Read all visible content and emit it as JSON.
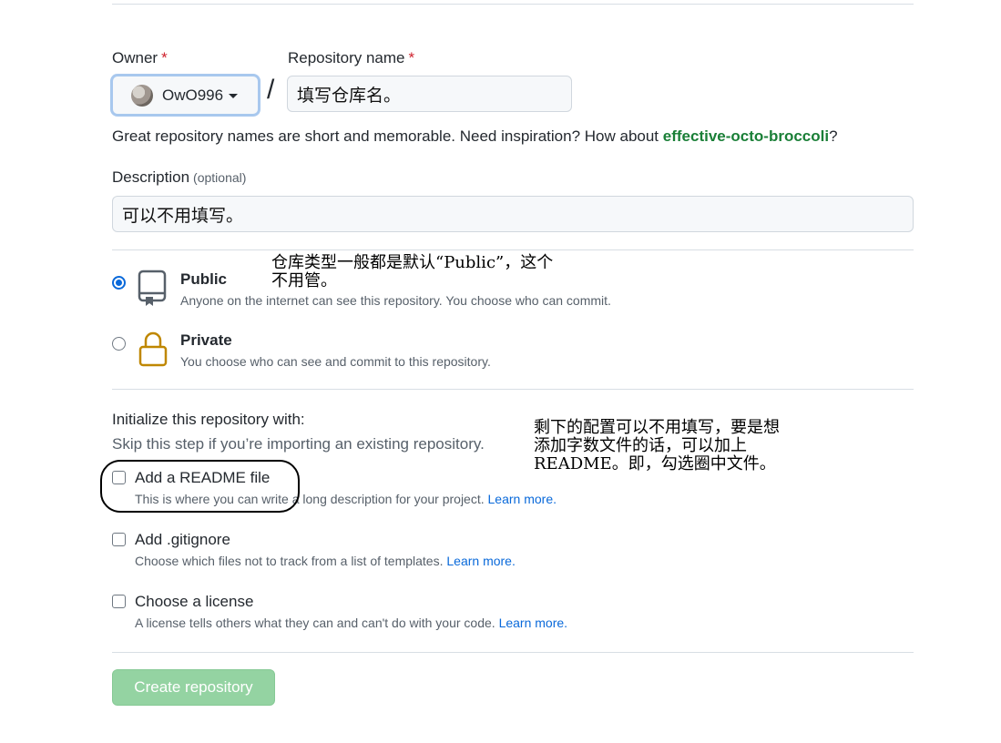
{
  "owner": {
    "label": "Owner",
    "required_mark": "*",
    "value": "OwO996"
  },
  "repo_name": {
    "label": "Repository name",
    "required_mark": "*",
    "value": "填写仓库名。"
  },
  "name_hint": {
    "prefix": "Great repository names are short and memorable. Need inspiration? How about ",
    "suggestion": "effective-octo-broccoli",
    "suffix": "?"
  },
  "description": {
    "label": "Description",
    "optional": "(optional)",
    "value": "可以不用填写。"
  },
  "visibility": {
    "public": {
      "title": "Public",
      "desc": "Anyone on the internet can see this repository. You choose who can commit.",
      "checked": true
    },
    "private": {
      "title": "Private",
      "desc": "You choose who can see and commit to this repository.",
      "checked": false
    }
  },
  "initialize": {
    "heading": "Initialize this repository with:",
    "subheading": "Skip this step if you’re importing an existing repository.",
    "readme": {
      "title": "Add a README file",
      "desc": "This is where you can write a long description for your project.",
      "link": "Learn more."
    },
    "gitignore": {
      "title": "Add .gitignore",
      "desc": "Choose which files not to track from a list of templates.",
      "link": "Learn more."
    },
    "license": {
      "title": "Choose a license",
      "desc": "A license tells others what they can and can't do with your code.",
      "link": "Learn more."
    }
  },
  "create_button": "Create repository",
  "annotations": {
    "visibility_line1": "仓库类型一般都是默认“Public”，这个",
    "visibility_line2": "不用管。",
    "init_line1": "剩下的配置可以不用填写，要是想",
    "init_line2": "添加字数文件的话，可以加上",
    "init_line3": "README。即，勾选圈中文件。"
  },
  "colors": {
    "required": "#cf222e",
    "suggestion": "#1a7f37",
    "link": "#0969da",
    "create_button_bg": "#94d3a2"
  }
}
